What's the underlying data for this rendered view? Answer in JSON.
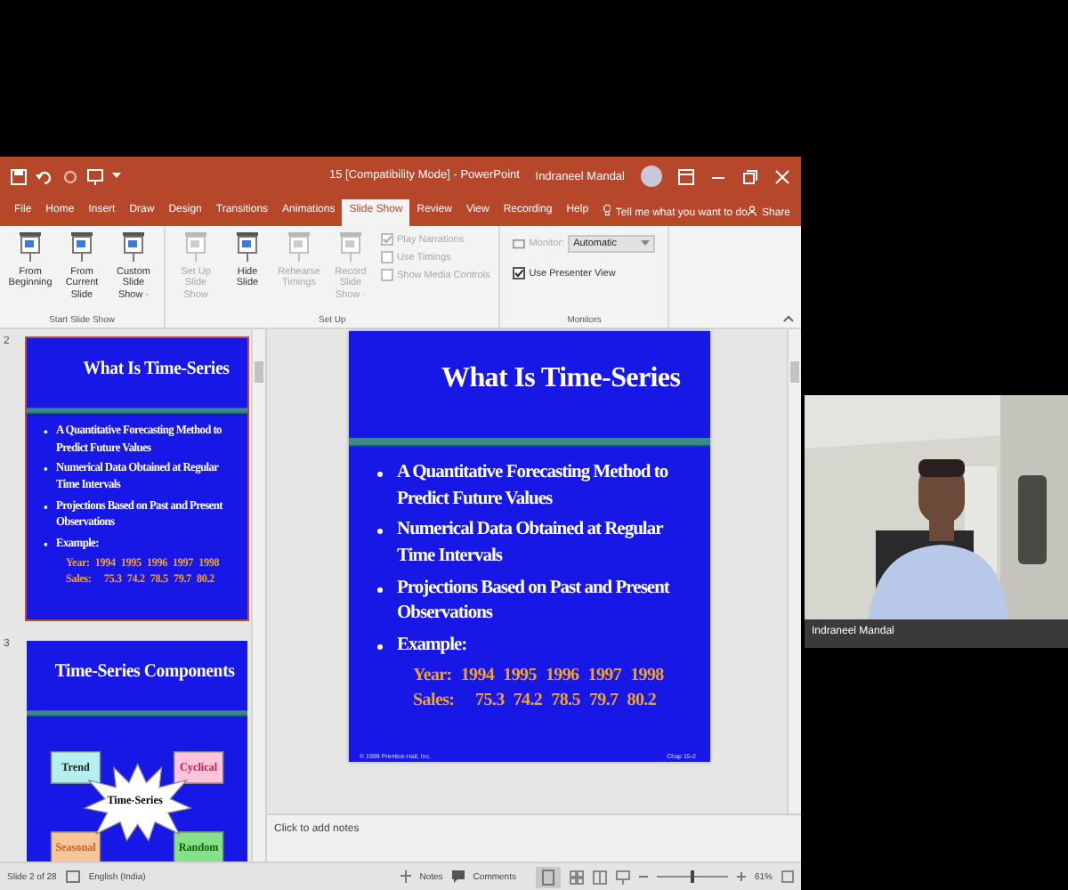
{
  "window": {
    "title": "15 [Compatibility Mode] - PowerPoint",
    "user": "Indraneel Mandal"
  },
  "tabs": [
    {
      "label": "File",
      "selected": false
    },
    {
      "label": "Home",
      "selected": false
    },
    {
      "label": "Insert",
      "selected": false
    },
    {
      "label": "Draw",
      "selected": false
    },
    {
      "label": "Design",
      "selected": false
    },
    {
      "label": "Transitions",
      "selected": false
    },
    {
      "label": "Animations",
      "selected": false
    },
    {
      "label": "Slide Show",
      "selected": true
    },
    {
      "label": "Review",
      "selected": false
    },
    {
      "label": "View",
      "selected": false
    },
    {
      "label": "Recording",
      "selected": false
    },
    {
      "label": "Help",
      "selected": false
    }
  ],
  "tell_me": "Tell me what you want to do",
  "share": "Share",
  "ribbon_groups": [
    {
      "label": "Start Slide Show",
      "commands": [
        {
          "kind": "button",
          "label": "From Beginning",
          "disabled": false
        },
        {
          "kind": "button",
          "label": "From Current Slide",
          "disabled": false
        },
        {
          "kind": "button",
          "label": "Custom Slide Show ·",
          "disabled": false
        }
      ]
    },
    {
      "label": "Set Up",
      "commands": [
        {
          "kind": "button",
          "label": "Set Up Slide Show",
          "disabled": true
        },
        {
          "kind": "button",
          "label": "Hide Slide",
          "disabled": false
        },
        {
          "kind": "button",
          "label": "Rehearse Timings",
          "disabled": true
        },
        {
          "kind": "button",
          "label": "Record Slide Show ·",
          "disabled": true
        },
        {
          "kind": "checks",
          "items": [
            {
              "label": "Play Narrations",
              "checked": true,
              "disabled": true
            },
            {
              "label": "Use Timings",
              "checked": false,
              "disabled": true
            },
            {
              "label": "Show Media Controls",
              "checked": false,
              "disabled": true
            }
          ]
        }
      ]
    },
    {
      "label": "Monitors",
      "commands": [
        {
          "kind": "monitor",
          "label": "Monitor:",
          "value": "Automatic",
          "disabled": true,
          "items": [
            {
              "label": "Use Presenter View",
              "checked": true,
              "disabled": false
            }
          ]
        }
      ]
    }
  ],
  "thumbnails": [
    {
      "number": "2",
      "selected": true,
      "kind": "bullets",
      "title": "What Is Time-Series",
      "bullets": [
        "A Quantitative Forecasting Method to Predict Future Values",
        "Numerical Data Obtained at Regular Time Intervals",
        "Projections Based on Past and Present Observations",
        "Example:"
      ],
      "example": [
        {
          "label": "Year:",
          "values": [
            "1994",
            "1995",
            "1996",
            "1997",
            "1998"
          ]
        },
        {
          "label": "Sales:",
          "values": [
            "75.3",
            "74.2",
            "78.5",
            "79.7",
            "80.2"
          ]
        }
      ]
    },
    {
      "number": "3",
      "selected": false,
      "kind": "diagram",
      "title": "Time-Series Components",
      "center": "Time-Series",
      "boxes": [
        {
          "label": "Trend",
          "color": "#b4f0f0"
        },
        {
          "label": "Cyclical",
          "color": "#ffc4dc"
        },
        {
          "label": "Seasonal",
          "color": "#f6c69a"
        },
        {
          "label": "Random",
          "color": "#86e08a"
        }
      ]
    }
  ],
  "slide": {
    "kind": "bullets",
    "title": "What Is Time-Series",
    "bullets": [
      "A Quantitative Forecasting Method to Predict Future Values",
      "Numerical Data Obtained at Regular Time Intervals",
      "Projections Based on Past and Present Observations",
      "Example:"
    ],
    "example": [
      {
        "label": "Year:",
        "values": [
          "1994",
          "1995",
          "1996",
          "1997",
          "1998"
        ]
      },
      {
        "label": "Sales:",
        "values": [
          "75.3",
          "74.2",
          "78.5",
          "79.7",
          "80.2"
        ]
      }
    ],
    "footer_left": "© 1999 Prentice-Hall, Inc.",
    "footer_right": "Chap 15-2"
  },
  "notes": {
    "placeholder": "Click to add notes"
  },
  "status_bar": {
    "slide": "Slide 2 of 28",
    "language": "English (India)",
    "notes": "Notes",
    "comments": "Comments",
    "zoom": {
      "level": 0.5
    },
    "zoom_text": "61%"
  },
  "video": {
    "name": "Indraneel Mandal"
  }
}
